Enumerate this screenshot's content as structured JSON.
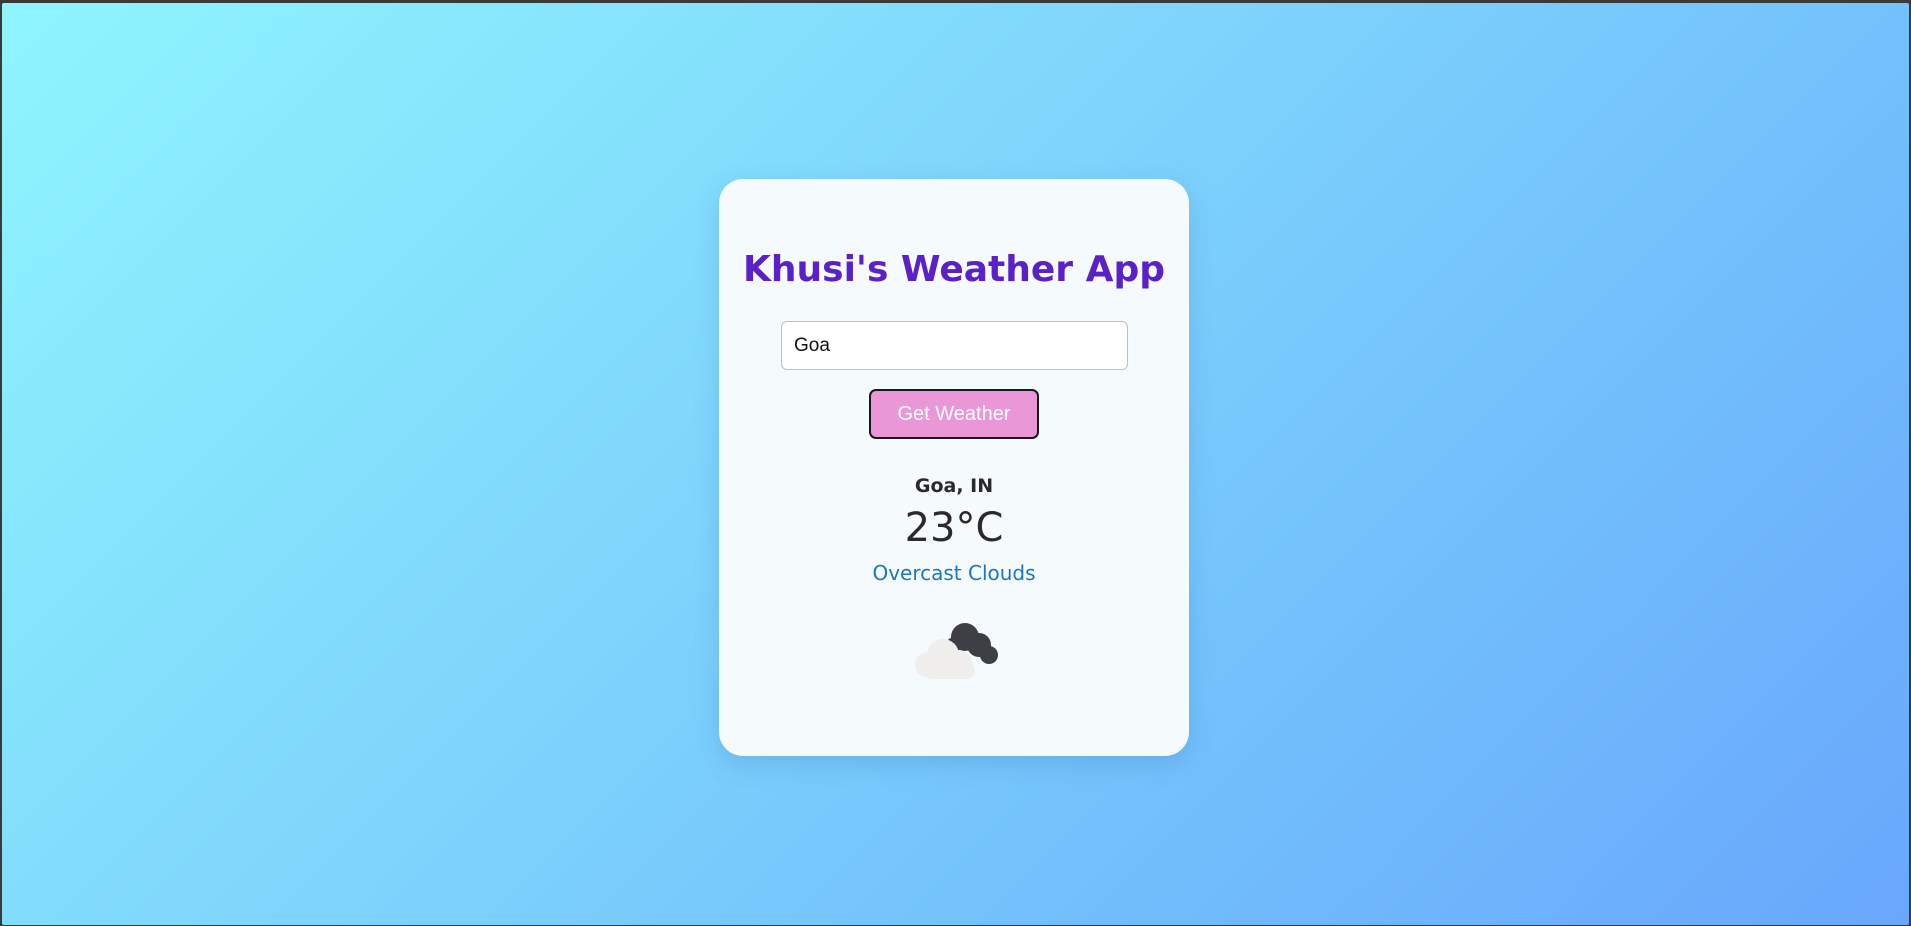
{
  "app": {
    "title": "Khusi's Weather App"
  },
  "search": {
    "value": "Goa",
    "button_label": "Get Weather"
  },
  "weather": {
    "location": "Goa, IN",
    "temperature": "23°C",
    "description": "Overcast Clouds",
    "icon": "overcast-clouds-icon"
  },
  "colors": {
    "title": "#5b21c9",
    "button_bg": "#e997d6",
    "description": "#1f74c2",
    "background_start": "#8ff5fd",
    "background_end": "#69a7fc"
  }
}
